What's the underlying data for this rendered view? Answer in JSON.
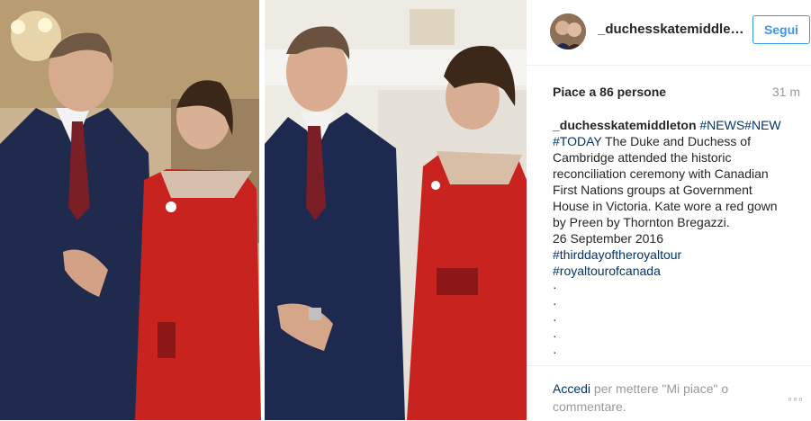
{
  "post": {
    "username": "_duchesskatemiddle…",
    "follow_label": "Segui",
    "likes": "Piace a 86 persone",
    "time": "31 m",
    "caption_user": "_duchesskatemiddleton",
    "caption_tags_line1": "#NEWS#NEW",
    "caption_tags_line2": "#TODAY",
    "caption_line2_text": "The Duke and Duchess of",
    "caption_line3": "Cambridge attended the historic",
    "caption_line4": "reconciliation ceremony with Canadian",
    "caption_line5": "First Nations groups at Government",
    "caption_line6": "House in Victoria. Kate wore a red gown",
    "caption_line7": "by Preen by Thornton Bregazzi.",
    "caption_line8": "26 September 2016",
    "hashtag1": "#thirddayoftheroyaltour",
    "hashtag2": "#royaltourofcanada",
    "dots": [
      "·",
      "·",
      "·",
      "·",
      "·"
    ]
  },
  "footer": {
    "login_label": "Accedi",
    "comment_prompt": "per mettere \"Mi piace\" o commentare.",
    "more_label": "◦◦◦"
  },
  "colors": {
    "accent": "#3897f0",
    "hashtag": "#003569",
    "muted": "#999999",
    "dress_red": "#c9231f",
    "suit_navy": "#1f2a4d"
  }
}
